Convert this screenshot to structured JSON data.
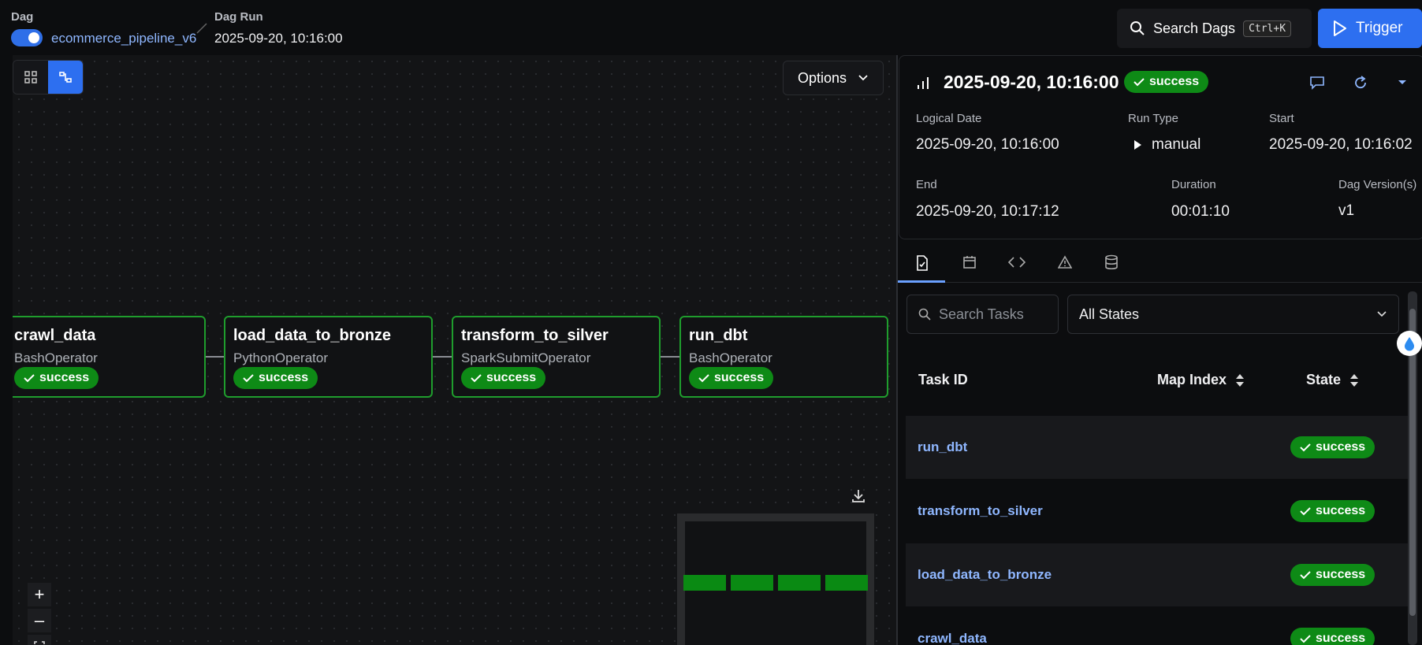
{
  "header": {
    "dag_label": "Dag",
    "dag_name": "ecommerce_pipeline_v6",
    "run_label": "Dag Run",
    "run_value": "2025-09-20, 10:16:00",
    "search_label": "Search Dags",
    "search_shortcut": "Ctrl+K",
    "trigger_label": "Trigger"
  },
  "graph": {
    "options_label": "Options",
    "nodes": [
      {
        "name": "crawl_data",
        "operator": "BashOperator",
        "state": "success"
      },
      {
        "name": "load_data_to_bronze",
        "operator": "PythonOperator",
        "state": "success"
      },
      {
        "name": "transform_to_silver",
        "operator": "SparkSubmitOperator",
        "state": "success"
      },
      {
        "name": "run_dbt",
        "operator": "BashOperator",
        "state": "success"
      }
    ],
    "zoom_in": "+",
    "zoom_out": "–"
  },
  "run": {
    "title": "2025-09-20, 10:16:00",
    "state": "success",
    "logical_date_label": "Logical Date",
    "logical_date": "2025-09-20, 10:16:00",
    "run_type_label": "Run Type",
    "run_type": "manual",
    "start_label": "Start",
    "start": "2025-09-20, 10:16:02",
    "end_label": "End",
    "end": "2025-09-20, 10:17:12",
    "duration_label": "Duration",
    "duration": "00:01:10",
    "version_label": "Dag Version(s)",
    "version": "v1"
  },
  "tasks": {
    "search_placeholder": "Search Tasks",
    "state_filter": "All States",
    "columns": {
      "task_id": "Task ID",
      "map_index": "Map Index",
      "state": "State"
    },
    "rows": [
      {
        "task_id": "run_dbt",
        "state": "success"
      },
      {
        "task_id": "transform_to_silver",
        "state": "success"
      },
      {
        "task_id": "load_data_to_bronze",
        "state": "success"
      },
      {
        "task_id": "crawl_data",
        "state": "success"
      }
    ]
  },
  "colors": {
    "accent": "#2d6ff0",
    "success": "#0e8a16",
    "node_border": "#1f9d2d",
    "link": "#8fb7ff"
  }
}
